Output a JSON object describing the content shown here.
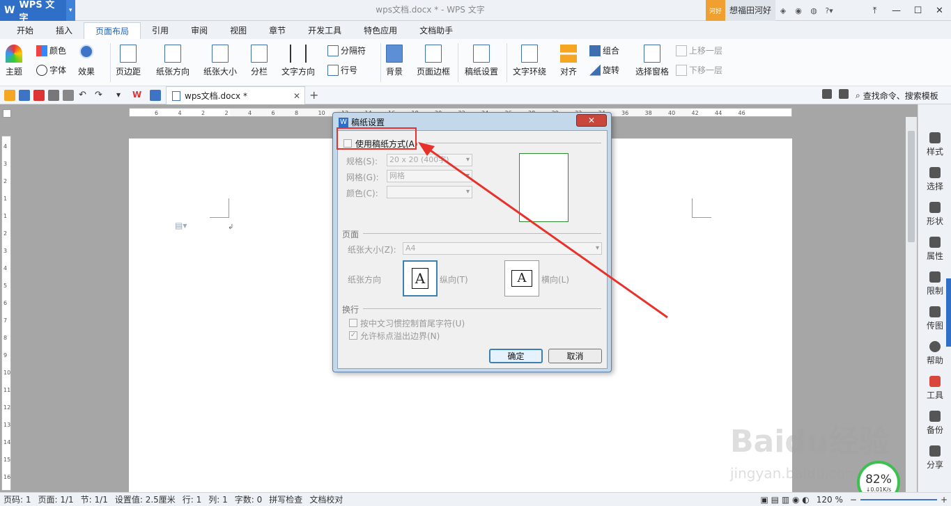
{
  "app": {
    "name": "WPS 文字",
    "window_title": "wps文档.docx * - WPS 文字"
  },
  "user": {
    "badge": "河好",
    "name": "想福田河好"
  },
  "menu_tabs": [
    "开始",
    "插入",
    "页面布局",
    "引用",
    "审阅",
    "视图",
    "章节",
    "开发工具",
    "特色应用",
    "文档助手"
  ],
  "active_tab": "页面布局",
  "ribbon": {
    "theme": "主题",
    "color": "颜色",
    "font": "字体",
    "effect": "效果",
    "margins": "页边距",
    "orientation": "纸张方向",
    "paper_size": "纸张大小",
    "columns": "分栏",
    "text_direction": "文字方向",
    "separator": "分隔符",
    "line_number": "行号",
    "background": "背景",
    "page_border": "页面边框",
    "manuscript": "稿纸设置",
    "text_wrap": "文字环绕",
    "align": "对齐",
    "group": "组合",
    "rotate": "旋转",
    "selection_pane": "选择窗格",
    "bring_forward": "上移一层",
    "send_backward": "下移一层"
  },
  "document_tab": "wps文档.docx *",
  "search": "查找命令、搜索模板",
  "ruler_labels": [
    "6",
    "4",
    "2",
    "2",
    "4",
    "6",
    "8",
    "10",
    "12",
    "14",
    "16",
    "18",
    "20",
    "22",
    "24",
    "26",
    "28",
    "30",
    "32",
    "34",
    "36",
    "38",
    "40",
    "42",
    "44",
    "46"
  ],
  "vruler_labels": [
    "4",
    "3",
    "2",
    "1",
    "1",
    "2",
    "3",
    "4",
    "5",
    "6",
    "7",
    "8",
    "9",
    "10",
    "11",
    "12",
    "13",
    "14",
    "15",
    "16"
  ],
  "right_panel": [
    "样式",
    "选择",
    "形状",
    "属性",
    "限制",
    "传图",
    "帮助",
    "工具",
    "备份",
    "分享"
  ],
  "dialog": {
    "title": "稿纸设置",
    "close": "✕",
    "use_manuscript": "使用稿纸方式(A)",
    "spec_label": "规格(S):",
    "spec_value": "20 x 20 (400字)",
    "grid_label": "网格(G):",
    "grid_value": "网格",
    "color_label": "颜色(C):",
    "color_value": "",
    "page_section": "页面",
    "paper_size_label": "纸张大小(Z):",
    "paper_size_value": "A4",
    "orientation_label": "纸张方向",
    "portrait": "纵向(T)",
    "landscape": "横向(L)",
    "line_break_section": "换行",
    "opt1": "按中文习惯控制首尾字符(U)",
    "opt2": "允许标点溢出边界(N)",
    "ok": "确定",
    "cancel": "取消"
  },
  "status": {
    "page_num": "页码: 1",
    "pages": "页面: 1/1",
    "section": "节: 1/1",
    "setting": "设置值: 2.5厘米",
    "row": "行: 1",
    "col": "列: 1",
    "words": "字数: 0",
    "spell": "拼写检查",
    "proof": "文档校对",
    "zoom": "120 %"
  },
  "net_badge": {
    "percent": "82%",
    "speed": "↓0.01K/s"
  },
  "watermark": {
    "brand": "Baidu经验",
    "url": "jingyan.baidu.com"
  },
  "colors": {
    "accent": "#2f6fc7",
    "highlight": "#e8312a",
    "dialog_frame": "#c4d8ec"
  }
}
